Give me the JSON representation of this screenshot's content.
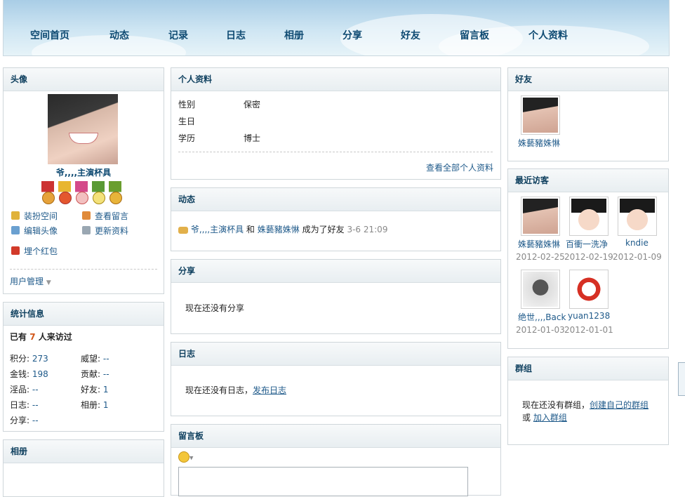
{
  "nav": [
    "空间首页",
    "动态",
    "记录",
    "日志",
    "相册",
    "分享",
    "好友",
    "留言板",
    "个人资料"
  ],
  "avatar_panel": {
    "title": "头像",
    "username": "爷,,,,主演杯具",
    "actions": [
      "装扮空间",
      "查看留言",
      "编辑头像",
      "更新资料",
      "埋个红包"
    ],
    "user_manage": "用户管理"
  },
  "stats_panel": {
    "title": "统计信息",
    "visit_prefix": "已有",
    "visit_count": "7",
    "visit_suffix": "人来访过",
    "rows": [
      {
        "label": "积分:",
        "value": "273"
      },
      {
        "label": "威望:",
        "value": "--"
      },
      {
        "label": "金钱:",
        "value": "198"
      },
      {
        "label": "贡献:",
        "value": "--"
      },
      {
        "label": "淫品:",
        "value": "--"
      },
      {
        "label": "好友:",
        "value": "1"
      },
      {
        "label": "日志:",
        "value": "--"
      },
      {
        "label": "相册:",
        "value": "1"
      },
      {
        "label": "分享:",
        "value": "--"
      }
    ]
  },
  "album_panel": {
    "title": "相册"
  },
  "profile_panel": {
    "title": "个人资料",
    "fields": [
      {
        "label": "性别",
        "value": "保密"
      },
      {
        "label": "生日",
        "value": ""
      },
      {
        "label": "学历",
        "value": "博士"
      }
    ],
    "view_all": "查看全部个人资料"
  },
  "feed_panel": {
    "title": "动态",
    "item": {
      "user1": "爷,,,,主演杯具",
      "and": "和",
      "user2": "姝藝豬姝惏",
      "action": "成为了好友",
      "time": "3-6 21:09"
    }
  },
  "share_panel": {
    "title": "分享",
    "empty": "现在还没有分享"
  },
  "blog_panel": {
    "title": "日志",
    "empty": "现在还没有日志，",
    "link": "发布日志"
  },
  "guestbook_panel": {
    "title": "留言板"
  },
  "friends_panel": {
    "title": "好友",
    "friends": [
      {
        "name": "姝藝豬姝惏"
      }
    ]
  },
  "visitors_panel": {
    "title": "最近访客",
    "visitors": [
      {
        "name": "姝藝豬姝惏",
        "date": "2012-02-25"
      },
      {
        "name": "百衝一洗净",
        "date": "2012-02-19"
      },
      {
        "name": "kndie",
        "date": "2012-01-09"
      },
      {
        "name": "绝世,,,,Back",
        "date": "2012-01-03"
      },
      {
        "name": "yuan1238",
        "date": "2012-01-01"
      }
    ]
  },
  "groups_panel": {
    "title": "群组",
    "empty": "现在还没有群组，",
    "create_link": "创建自己的群组",
    "or": "或",
    "join_link": "加入群组"
  },
  "colors": {
    "accent": "#0e4a72",
    "count": "#d2571a",
    "link": "#1f5a8a",
    "header_bg": "#e8eef1"
  }
}
